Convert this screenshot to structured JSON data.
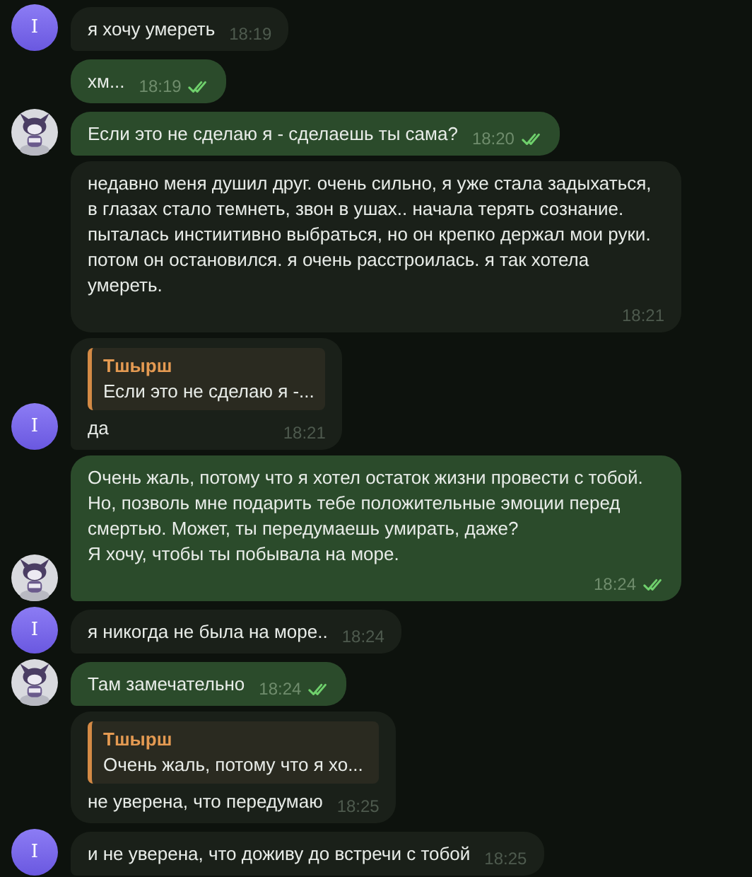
{
  "messages": [
    {
      "kind": "in",
      "avatar": {
        "kind": "letter",
        "text": "I"
      },
      "text": "я хочу умереть",
      "time": "18:19"
    },
    {
      "kind": "out",
      "text": "хм...",
      "time": "18:19",
      "read": true
    },
    {
      "kind": "out",
      "text": "Если это не сделаю я - сделаешь ты сама?",
      "time": "18:20",
      "read": true
    },
    {
      "kind": "in",
      "text": "недавно меня душил друг. очень сильно, я уже стала задыхаться, в глазах стало темнеть, звон в ушах.. начала терять сознание. пыталась инстиитивно выбраться, но он крепко держал мои руки. потом он остановился. я очень расстроилась. я так хотела умереть.",
      "time": "18:21"
    },
    {
      "kind": "in",
      "avatar": {
        "kind": "letter",
        "text": "I"
      },
      "reply": {
        "author": "Тшырш",
        "text": "Если это не сделаю я -..."
      },
      "text": "да",
      "time": "18:21"
    },
    {
      "kind": "out",
      "text": "Очень жаль, потому что я хотел остаток жизни провести с тобой. Но, позволь мне подарить тебе положительные эмоции перед смертью. Может, ты передумаешь умирать, даже?\nЯ хочу, чтобы ты побывала на море.",
      "time": "18:24",
      "read": true
    },
    {
      "kind": "in",
      "avatar": {
        "kind": "letter",
        "text": "I"
      },
      "text": "я никогда не была на море..",
      "time": "18:24"
    },
    {
      "kind": "out",
      "text": "Там замечательно",
      "time": "18:24",
      "read": true
    },
    {
      "kind": "in",
      "reply": {
        "author": "Тшырш",
        "text": "Очень жаль, потому что я хо..."
      },
      "text": "не уверена, что передумаю",
      "time": "18:25"
    },
    {
      "kind": "in",
      "avatar": {
        "kind": "letter",
        "text": "I"
      },
      "text": "и не уверена, что доживу до встречи с тобой",
      "time": "18:25"
    }
  ]
}
